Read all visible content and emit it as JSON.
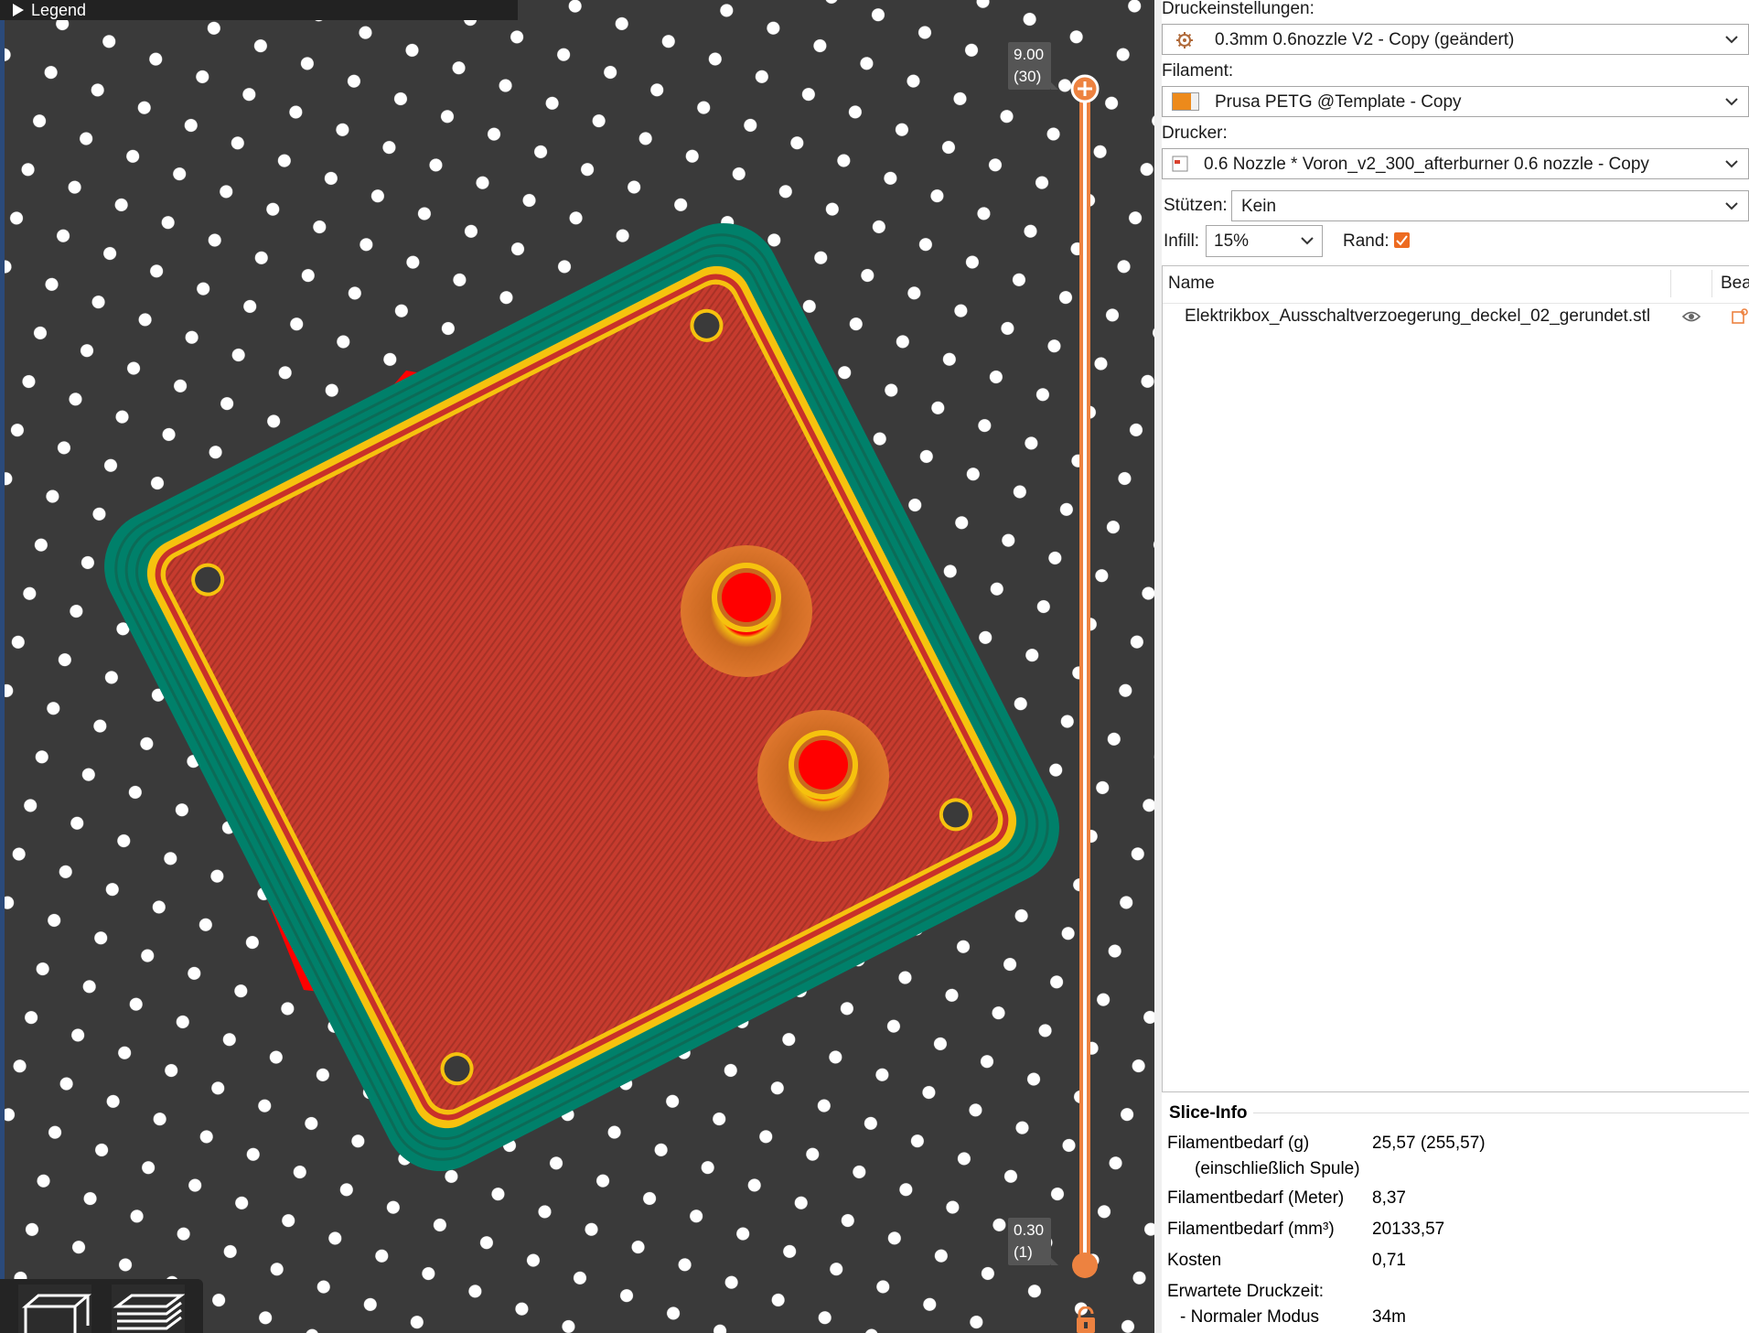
{
  "viewport": {
    "legend_label": "Legend",
    "colors": {
      "background": "#3a3a3a",
      "bed_dots": "#ffffff",
      "skin": "#c0392b",
      "outline": "#ff0000",
      "skirt": "#00806a",
      "perimeter": "#f6c20e",
      "slider": "#ed8240"
    },
    "layer_slider": {
      "top_height": "9.00",
      "top_layer": "(30)",
      "bottom_height": "0.30",
      "bottom_layer": "(1)"
    },
    "icons": [
      "play-triangle-icon",
      "plus-icon",
      "lock-open-icon",
      "cube-view-icon",
      "layers-view-icon"
    ]
  },
  "panel": {
    "print_settings_label": "Druckeinstellungen:",
    "print_settings_value": "0.3mm 0.6nozzle V2 - Copy (geändert)",
    "filament_label": "Filament:",
    "filament_value": "Prusa PETG @Template - Copy",
    "filament_color": "#ed8a1b",
    "printer_label": "Drucker:",
    "printer_value": "0.6 Nozzle * Voron_v2_300_afterburner 0.6 nozzle - Copy",
    "supports_label": "Stützen:",
    "supports_value": "Kein",
    "infill_label": "Infill:",
    "infill_value": "15%",
    "brim_label": "Rand:",
    "brim_checked": true,
    "objects": {
      "col_name": "Name",
      "col_edit": "Bea",
      "items": [
        {
          "name": "Elektrikbox_Ausschaltverzoegerung_deckel_02_gerundet.stl"
        }
      ]
    },
    "slice_info": {
      "title": "Slice-Info",
      "rows": [
        {
          "key": "Filamentbedarf (g)",
          "value": "25,57 (255,57)"
        },
        {
          "key": "(einschließlich Spule)",
          "value": ""
        },
        {
          "key": "Filamentbedarf (Meter)",
          "value": "8,37"
        },
        {
          "key": "Filamentbedarf (mm³)",
          "value": "20133,57"
        },
        {
          "key": "Kosten",
          "value": "0,71"
        },
        {
          "key": "Erwartete Druckzeit:",
          "value": ""
        },
        {
          "key": "- Normaler Modus",
          "value": "34m"
        }
      ]
    }
  }
}
